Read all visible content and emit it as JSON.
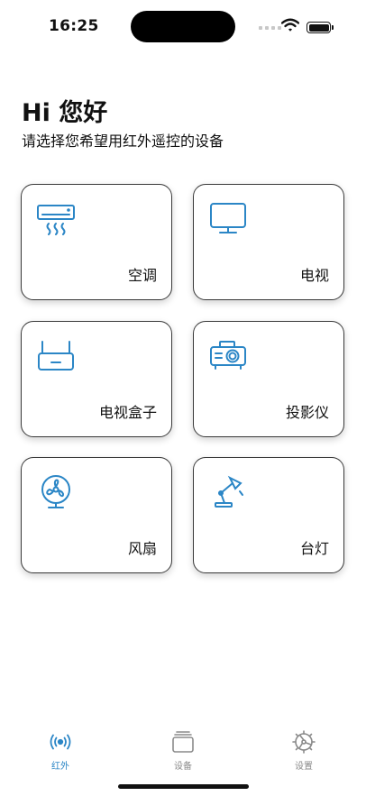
{
  "status_bar": {
    "time": "16:25"
  },
  "header": {
    "greeting": "Hi 您好",
    "subtitle": "请选择您希望用红外遥控的设备"
  },
  "devices": [
    {
      "label": "空调",
      "icon": "air-conditioner-icon"
    },
    {
      "label": "电视",
      "icon": "tv-icon"
    },
    {
      "label": "电视盒子",
      "icon": "tv-box-icon"
    },
    {
      "label": "投影仪",
      "icon": "projector-icon"
    },
    {
      "label": "风扇",
      "icon": "fan-icon"
    },
    {
      "label": "台灯",
      "icon": "desk-lamp-icon"
    }
  ],
  "tabs": [
    {
      "label": "红外",
      "icon": "infrared-icon",
      "active": true
    },
    {
      "label": "设备",
      "icon": "devices-icon",
      "active": false
    },
    {
      "label": "设置",
      "icon": "settings-icon",
      "active": false
    }
  ],
  "colors": {
    "accent": "#2b86c6",
    "inactive": "#8a8a8a"
  }
}
